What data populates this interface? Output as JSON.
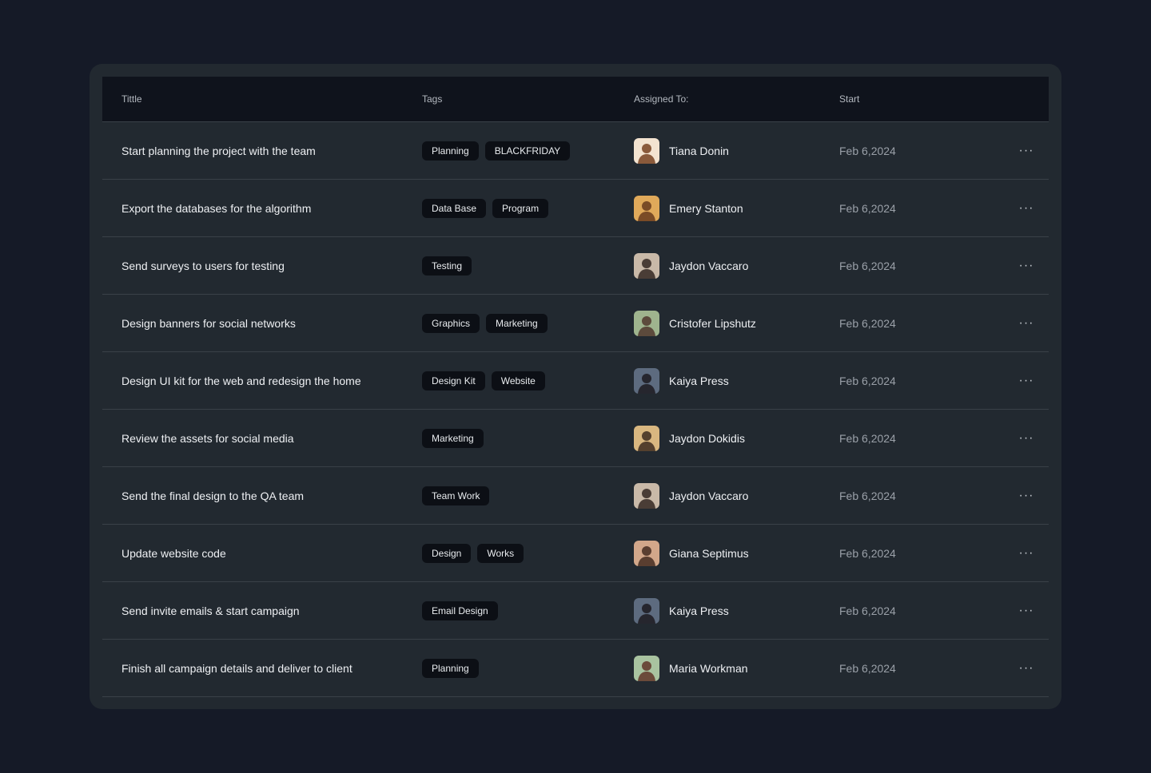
{
  "table": {
    "headers": {
      "title": "Tittle",
      "tags": "Tags",
      "assigned": "Assigned To:",
      "start": "Start"
    },
    "rows": [
      {
        "title": "Start planning the project with the team",
        "tags": [
          "Planning",
          "BLACKFRIDAY"
        ],
        "assignee": "Tiana Donin",
        "start": "Feb 6,2024",
        "avatar_colors": [
          "#f3e3d0",
          "#8a5a3b"
        ]
      },
      {
        "title": "Export the databases for the algorithm",
        "tags": [
          "Data Base",
          "Program"
        ],
        "assignee": "Emery Stanton",
        "start": "Feb 6,2024",
        "avatar_colors": [
          "#e0a95a",
          "#7a4b26"
        ]
      },
      {
        "title": "Send surveys to users for testing",
        "tags": [
          "Testing"
        ],
        "assignee": "Jaydon Vaccaro",
        "start": "Feb 6,2024",
        "avatar_colors": [
          "#c9b9a8",
          "#4a3d36"
        ]
      },
      {
        "title": "Design banners for social networks",
        "tags": [
          "Graphics",
          "Marketing"
        ],
        "assignee": "Cristofer Lipshutz",
        "start": "Feb 6,2024",
        "avatar_colors": [
          "#9fb48e",
          "#5c4a3c"
        ]
      },
      {
        "title": "Design UI kit for the web and redesign the home",
        "tags": [
          "Design Kit",
          "Website"
        ],
        "assignee": "Kaiya Press",
        "start": "Feb 6,2024",
        "avatar_colors": [
          "#5d6b7f",
          "#26262e"
        ]
      },
      {
        "title": "Review the assets for social media",
        "tags": [
          "Marketing"
        ],
        "assignee": "Jaydon Dokidis",
        "start": "Feb 6,2024",
        "avatar_colors": [
          "#d9b780",
          "#54402e"
        ]
      },
      {
        "title": "Send the final design to the QA team",
        "tags": [
          "Team Work"
        ],
        "assignee": "Jaydon Vaccaro",
        "start": "Feb 6,2024",
        "avatar_colors": [
          "#c9b9a8",
          "#4a3d36"
        ]
      },
      {
        "title": "Update website code",
        "tags": [
          "Design",
          "Works"
        ],
        "assignee": "Giana Septimus",
        "start": "Feb 6,2024",
        "avatar_colors": [
          "#d2a78a",
          "#5a3e30"
        ]
      },
      {
        "title": "Send invite emails & start campaign",
        "tags": [
          "Email Design"
        ],
        "assignee": "Kaiya Press",
        "start": "Feb 6,2024",
        "avatar_colors": [
          "#5d6b7f",
          "#26262e"
        ]
      },
      {
        "title": "Finish all campaign details and deliver to client",
        "tags": [
          "Planning"
        ],
        "assignee": "Maria Workman",
        "start": "Feb 6,2024",
        "avatar_colors": [
          "#a9c3a0",
          "#6b4a3a"
        ]
      }
    ],
    "row_menu_icon": "more-horizontal-icon"
  },
  "colors": {
    "page_bg": "#151a27",
    "card_bg": "#222930",
    "header_bg": "#0f131c",
    "tag_bg": "#0c0f15"
  }
}
